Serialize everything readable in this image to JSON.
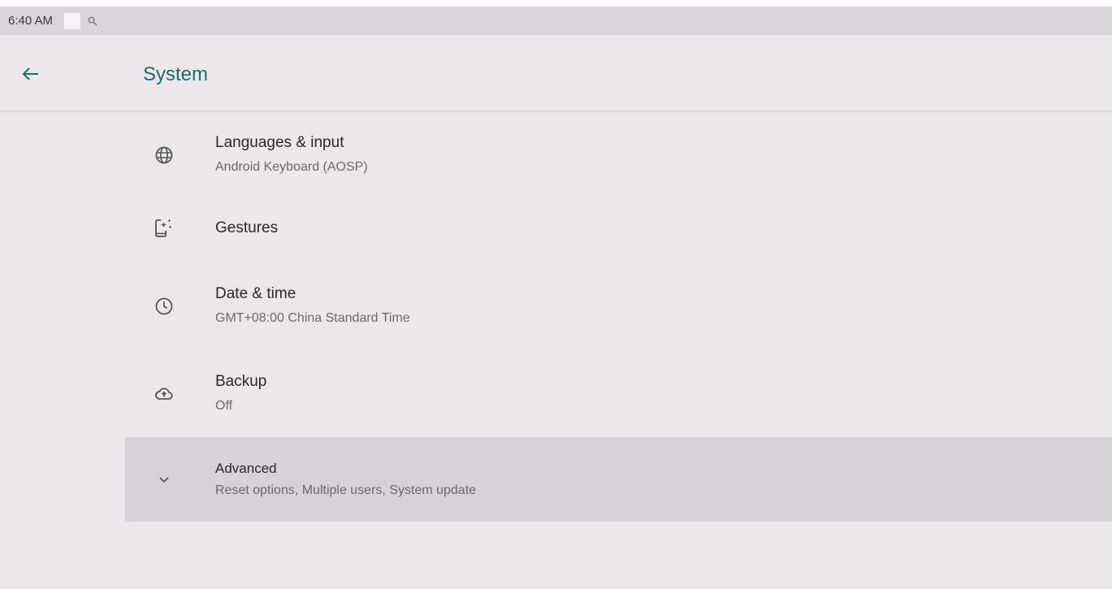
{
  "status_bar": {
    "time": "6:40 AM",
    "search_icon": "search-icon"
  },
  "app_bar": {
    "back_icon": "arrow-back-icon",
    "title": "System"
  },
  "items": [
    {
      "title": "Languages & input",
      "subtitle": "Android Keyboard (AOSP)",
      "icon": "globe-icon"
    },
    {
      "title": "Gestures",
      "subtitle": "",
      "icon": "gesture-phone-icon"
    },
    {
      "title": "Date & time",
      "subtitle": "GMT+08:00 China Standard Time",
      "icon": "clock-icon"
    },
    {
      "title": "Backup",
      "subtitle": "Off",
      "icon": "cloud-backup-icon"
    },
    {
      "title": "Advanced",
      "subtitle": "Reset options, Multiple users, System update",
      "icon": "chevron-down-icon"
    }
  ],
  "colors": {
    "accent": "#1d7065",
    "background": "#ebe7eb",
    "status_bar": "#d9d5da",
    "highlight_row": "#d6d2d7"
  }
}
